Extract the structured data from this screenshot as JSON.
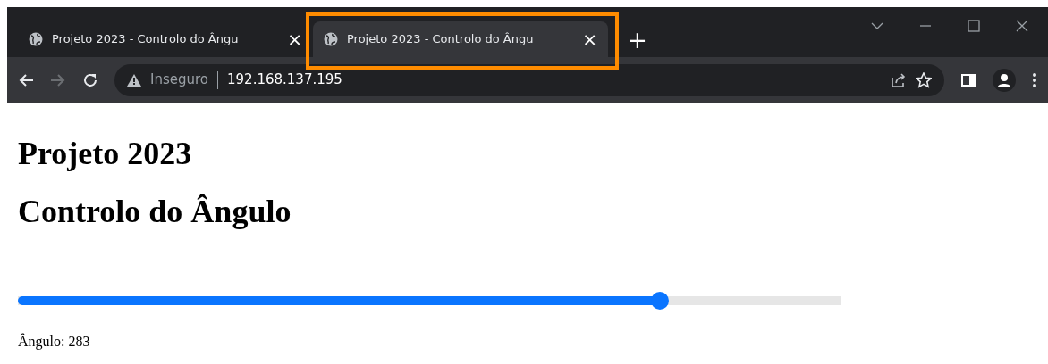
{
  "browser": {
    "tabs": [
      {
        "title": "Projeto 2023 - Controlo do Ângu",
        "close": "×",
        "selected": false,
        "highlighted": false
      },
      {
        "title": "Projeto 2023 - Controlo do Ângu",
        "close": "×",
        "selected": true,
        "highlighted": true
      }
    ],
    "new_tab": "+",
    "address_bar": {
      "security": "Inseguro",
      "url": "192.168.137.195"
    }
  },
  "page": {
    "headings": [
      "Projeto 2023",
      "Controlo do Ângulo"
    ],
    "slider": {
      "level": 0.78
    },
    "reading": "Ângulo: 283"
  }
}
